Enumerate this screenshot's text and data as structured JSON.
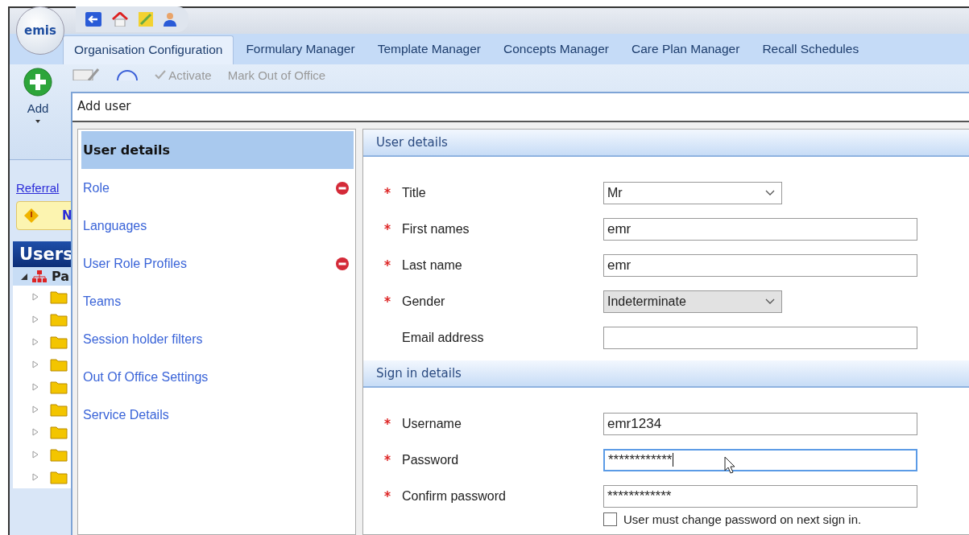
{
  "app": {
    "logo": "emis"
  },
  "tabs": [
    {
      "label": "Organisation Configuration",
      "selected": true
    },
    {
      "label": "Formulary Manager",
      "selected": false
    },
    {
      "label": "Template Manager",
      "selected": false
    },
    {
      "label": "Concepts Manager",
      "selected": false
    },
    {
      "label": "Care Plan Manager",
      "selected": false
    },
    {
      "label": "Recall Schedules",
      "selected": false
    }
  ],
  "ribbon": {
    "add_label": "Add",
    "activate_label": "Activate",
    "out_of_office_label": "Mark Out of Office"
  },
  "left_pane": {
    "link": "Referral",
    "warning_text": "N",
    "header": "Users",
    "tree": {
      "label": "Pa",
      "expanded": true,
      "children": [
        {
          "expanded": false
        },
        {
          "expanded": false
        },
        {
          "expanded": false
        },
        {
          "expanded": false
        },
        {
          "expanded": false
        },
        {
          "expanded": false
        },
        {
          "expanded": false
        },
        {
          "expanded": false
        },
        {
          "expanded": false
        }
      ]
    }
  },
  "dialog": {
    "title": "Add user",
    "nav": [
      {
        "label": "User details",
        "selected": true,
        "error": false
      },
      {
        "label": "Role",
        "selected": false,
        "error": true
      },
      {
        "label": "Languages",
        "selected": false,
        "error": false
      },
      {
        "label": "User Role Profiles",
        "selected": false,
        "error": true
      },
      {
        "label": "Teams",
        "selected": false,
        "error": false
      },
      {
        "label": "Session holder filters",
        "selected": false,
        "error": false
      },
      {
        "label": "Out Of Office Settings",
        "selected": false,
        "error": false
      },
      {
        "label": "Service Details",
        "selected": false,
        "error": false
      }
    ],
    "sections": [
      {
        "title": "User details",
        "fields": [
          {
            "label": "Title",
            "required": true,
            "kind": "select",
            "value": "Mr",
            "shaded": false,
            "focused": false
          },
          {
            "label": "First names",
            "required": true,
            "kind": "text",
            "value": "emr",
            "focused": false
          },
          {
            "label": "Last name",
            "required": true,
            "kind": "text",
            "value": "emr",
            "focused": false
          },
          {
            "label": "Gender",
            "required": true,
            "kind": "select",
            "value": "Indeterminate",
            "shaded": true,
            "focused": false
          },
          {
            "label": "Email address",
            "required": false,
            "kind": "text",
            "focused": false
          }
        ]
      },
      {
        "title": "Sign in details",
        "fields": [
          {
            "label": "Username",
            "required": true,
            "kind": "text",
            "value": "emr1234",
            "focused": false
          },
          {
            "label": "Password",
            "required": true,
            "kind": "text",
            "value": "************",
            "focused": true
          },
          {
            "label": "Confirm password",
            "required": true,
            "kind": "text",
            "value": "************",
            "focused": false
          }
        ]
      }
    ],
    "checkbox": {
      "label": "User must change password on next sign in.",
      "checked": false
    }
  }
}
